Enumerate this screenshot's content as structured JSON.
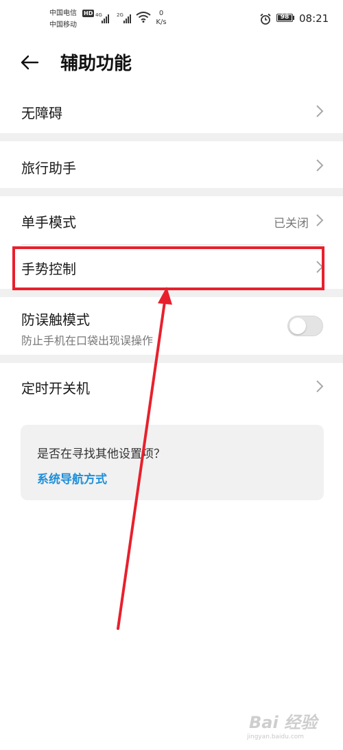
{
  "status_bar": {
    "carrier_1": "中国电信",
    "carrier_2": "中国移动",
    "hd_badge": "HD",
    "net_1": "4G",
    "net_2": "2G",
    "speed_value": "0",
    "speed_unit": "K/s",
    "battery_level": "98",
    "time": "08:21",
    "icons": [
      "signal-icon",
      "wifi-icon",
      "alarm-icon",
      "battery-icon"
    ]
  },
  "header": {
    "back_icon": "back-arrow-icon",
    "title": "辅助功能"
  },
  "settings": {
    "accessibility": "无障碍",
    "travel_assistant": "旅行助手",
    "one_hand_mode": "单手模式",
    "one_hand_mode_value": "已关闭",
    "gesture_control": "手势控制",
    "accidental_touch": "防误触模式",
    "accidental_touch_desc": "防止手机在口袋出现误操作",
    "accidental_touch_enabled": false,
    "scheduled_power": "定时开关机"
  },
  "suggestion": {
    "question": "是否在寻找其他设置项？",
    "link": "系统导航方式"
  },
  "watermark": {
    "text": "Bai 经验",
    "sub": "jingyan.baidu.com"
  },
  "colors": {
    "highlight": "#e8202c",
    "link": "#1f8fd8",
    "section_gap": "#f0f0f0"
  }
}
